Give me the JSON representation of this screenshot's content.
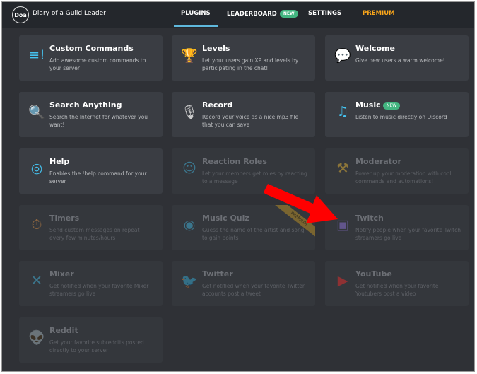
{
  "header": {
    "logo": "Doa",
    "server": "Diary of a Guild Leader",
    "nav": [
      "PLUGINS",
      "LEADERBOARD",
      "SETTINGS",
      "PREMIUM"
    ],
    "badge": "NEW",
    "active": "PLUGINS",
    "premium_color": "#faa61a"
  },
  "plugins": [
    {
      "title": "Custom Commands",
      "desc": "Add awesome custom commands to your server",
      "icon": "exclamation-list-icon",
      "enabled": true,
      "color": "#45c3f0"
    },
    {
      "title": "Levels",
      "desc": "Let your users gain XP and levels by participating in the chat!",
      "icon": "trophy-icon",
      "enabled": true,
      "color": "#f7c136"
    },
    {
      "title": "Welcome",
      "desc": "Give new users a warm welcome!",
      "icon": "speech-bubble-icon",
      "enabled": true,
      "color": "#45c3f0"
    },
    {
      "title": "Search Anything",
      "desc": "Search the Internet for whatever you want!",
      "icon": "magnifier-icon",
      "enabled": true,
      "color": "#45c3f0"
    },
    {
      "title": "Record",
      "desc": "Record your voice as a nice mp3 file that you can save",
      "icon": "microphone-icon",
      "enabled": true,
      "color": "#cccccc"
    },
    {
      "title": "Music",
      "desc": "Listen to music directly on Discord",
      "icon": "music-note-icon",
      "enabled": true,
      "badge": "NEW",
      "color": "#45c3f0"
    },
    {
      "title": "Help",
      "desc": "Enables the !help command for your server",
      "icon": "lifebuoy-icon",
      "enabled": true,
      "color": "#45c3f0"
    },
    {
      "title": "Reaction Roles",
      "desc": "Let your members get roles by reacting to a message",
      "icon": "smiley-icon",
      "enabled": false,
      "color": "#45c3f0"
    },
    {
      "title": "Moderator",
      "desc": "Power up your moderation with cool commands and automations!",
      "icon": "hammer-icon",
      "enabled": false,
      "color": "#f7c136"
    },
    {
      "title": "Timers",
      "desc": "Send custom messages on repeat every few minutes/hours",
      "icon": "stopwatch-icon",
      "enabled": false,
      "color": "#f09a45"
    },
    {
      "title": "Music Quiz",
      "desc": "Guess the name of the artist and song to gain points",
      "icon": "disc-icon",
      "enabled": false,
      "ribbon": "PREMIUM",
      "color": "#45c3f0"
    },
    {
      "title": "Twitch",
      "desc": "Notify people when your favorite Twitch streamers go live",
      "icon": "twitch-icon",
      "enabled": false,
      "color": "#9b7bf0"
    },
    {
      "title": "Mixer",
      "desc": "Get notified when your favorite Mixer streamers go live",
      "icon": "mixer-icon",
      "enabled": false,
      "color": "#45c3f0"
    },
    {
      "title": "Twitter",
      "desc": "Get notified when your favorite Twitter accounts post a tweet",
      "icon": "twitter-icon",
      "enabled": false,
      "color": "#45c3f0"
    },
    {
      "title": "YouTube",
      "desc": "Get notified when your favorite Youtubers post a video",
      "icon": "youtube-icon",
      "enabled": false,
      "color": "#ff2a2a"
    },
    {
      "title": "Reddit",
      "desc": "Get your favorite subreddits posted directly to your server",
      "icon": "reddit-icon",
      "enabled": false,
      "color": "#cccccc"
    }
  ]
}
